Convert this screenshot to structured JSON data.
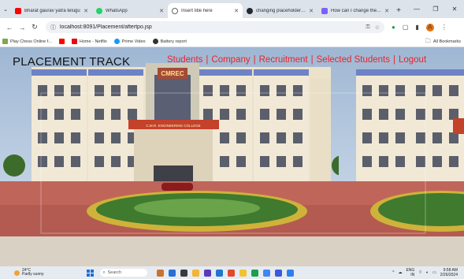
{
  "browser": {
    "tabs": [
      {
        "title": "Bharat gaurav yatra telugu",
        "icon_color": "#ff0000",
        "active": false
      },
      {
        "title": "WhatsApp",
        "icon_color": "#25d366",
        "active": false
      },
      {
        "title": "Insert title here",
        "icon_color": "#5f6368",
        "active": true
      },
      {
        "title": "changing placeholder text",
        "icon_color": "#24292f",
        "active": false
      },
      {
        "title": "How can I change the defa",
        "icon_color": "#7b61ff",
        "active": false
      }
    ],
    "new_tab_glyph": "+",
    "url": "localhost:8091/Placement/aftertpo.jsp",
    "bookmarks": [
      {
        "label": "Play Chess Online f...",
        "icon_color": "#7fa650"
      },
      {
        "label": "",
        "icon_color": "#ff0000"
      },
      {
        "label": "Home - Netflix",
        "icon_color": "#e50914"
      },
      {
        "label": "Prime Video",
        "icon_color": "#1399ff"
      },
      {
        "label": "Battery report",
        "icon_color": "#333333"
      }
    ],
    "all_bookmarks_label": "All Bookmarks"
  },
  "site": {
    "title": "PLACEMENT TRACK",
    "nav": [
      "Students",
      "Company",
      "Recruitment",
      "Selected Students",
      "Logout"
    ],
    "nav_color": "#e8242b",
    "building_sign": "CMREC",
    "banner_text": "C.M.R. ENGINEERING COLLEGE"
  },
  "taskbar": {
    "temperature": "24°C",
    "weather": "Partly sunny",
    "search_placeholder": "Search",
    "language": "ENG",
    "region": "IN",
    "time": "9:58 AM",
    "date": "2/26/2024"
  }
}
